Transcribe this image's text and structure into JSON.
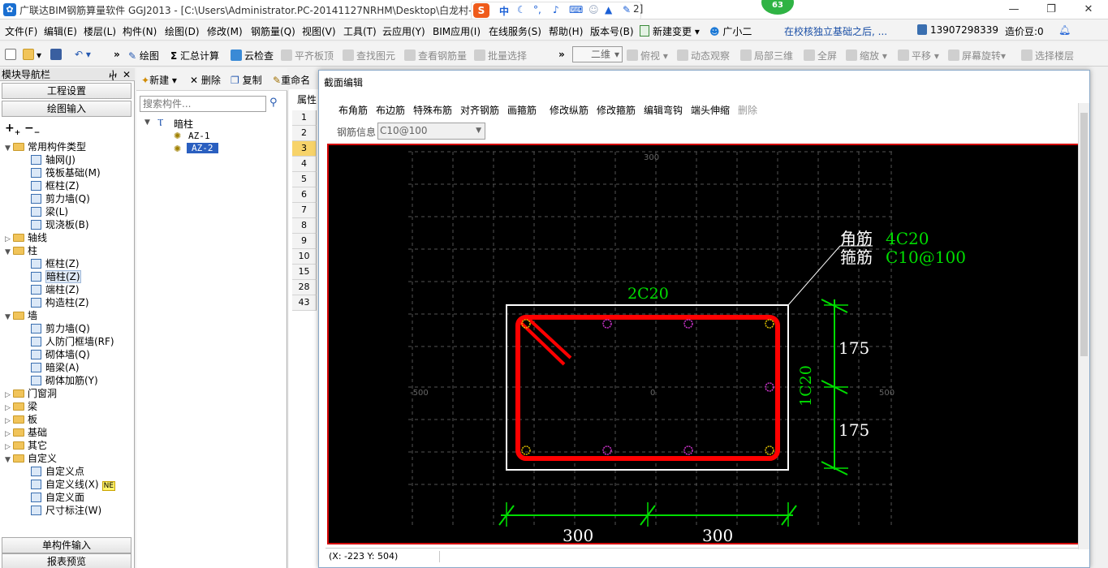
{
  "title": {
    "text": "广联达BIM钢筋算量软件 GGJ2013 - [C:\\Users\\Administrator.PC-20141127NRHM\\Desktop\\白龙村-",
    "right_fragment": "2]",
    "badge": "63"
  },
  "menu": {
    "items": [
      "文件(F)",
      "编辑(E)",
      "楼层(L)",
      "构件(N)",
      "绘图(D)",
      "修改(M)",
      "钢筋量(Q)",
      "视图(V)",
      "工具(T)",
      "云应用(Y)",
      "BIM应用(I)",
      "在线服务(S)",
      "帮助(H)",
      "版本号(B)",
      "新建变更",
      "广小二"
    ],
    "marquee": "在校核独立基础之后, ...",
    "phone": "13907298339",
    "beans": "造价豆:0"
  },
  "toolbar": {
    "draw": "绘图",
    "sum": "汇总计算",
    "cloud": "云检查",
    "align_top": "平齐板顶",
    "find": "查找图元",
    "view_rebar": "查看钢筋量",
    "batch": "批量选择",
    "view_mode": "二维",
    "top_view": "俯视",
    "dynamic": "动态观察",
    "local3d": "局部三维",
    "fullscreen": "全屏",
    "zoom": "缩放",
    "pan": "平移",
    "rotate": "屏幕旋转",
    "select_floor": "选择楼层"
  },
  "nav": {
    "title": "模块导航栏",
    "project": "工程设置",
    "drawing": "绘图输入",
    "single": "单构件输入",
    "report": "报表预览",
    "tree": [
      {
        "label": "常用构件类型",
        "level": 0,
        "folder": true,
        "open": true
      },
      {
        "label": "轴网(J)",
        "level": 1
      },
      {
        "label": "筏板基础(M)",
        "level": 1
      },
      {
        "label": "框柱(Z)",
        "level": 1
      },
      {
        "label": "剪力墙(Q)",
        "level": 1
      },
      {
        "label": "梁(L)",
        "level": 1
      },
      {
        "label": "现浇板(B)",
        "level": 1
      },
      {
        "label": "轴线",
        "level": 0,
        "folder": true,
        "open": false
      },
      {
        "label": "柱",
        "level": 0,
        "folder": true,
        "open": true
      },
      {
        "label": "框柱(Z)",
        "level": 1
      },
      {
        "label": "暗柱(Z)",
        "level": 1,
        "selected": true
      },
      {
        "label": "端柱(Z)",
        "level": 1
      },
      {
        "label": "构造柱(Z)",
        "level": 1
      },
      {
        "label": "墙",
        "level": 0,
        "folder": true,
        "open": true
      },
      {
        "label": "剪力墙(Q)",
        "level": 1
      },
      {
        "label": "人防门框墙(RF)",
        "level": 1
      },
      {
        "label": "砌体墙(Q)",
        "level": 1
      },
      {
        "label": "暗梁(A)",
        "level": 1
      },
      {
        "label": "砌体加筋(Y)",
        "level": 1
      },
      {
        "label": "门窗洞",
        "level": 0,
        "folder": true,
        "open": false
      },
      {
        "label": "梁",
        "level": 0,
        "folder": true,
        "open": false
      },
      {
        "label": "板",
        "level": 0,
        "folder": true,
        "open": false
      },
      {
        "label": "基础",
        "level": 0,
        "folder": true,
        "open": false
      },
      {
        "label": "其它",
        "level": 0,
        "folder": true,
        "open": false
      },
      {
        "label": "自定义",
        "level": 0,
        "folder": true,
        "open": true
      },
      {
        "label": "自定义点",
        "level": 1
      },
      {
        "label": "自定义线(X)",
        "level": 1,
        "badge": "NE"
      },
      {
        "label": "自定义面",
        "level": 1
      },
      {
        "label": "尺寸标注(W)",
        "level": 1
      }
    ]
  },
  "components": {
    "new": "新建",
    "delete": "删除",
    "copy": "复制",
    "rename": "重命名",
    "search_placeholder": "搜索构件...",
    "root": "暗柱",
    "items": [
      "AZ-1",
      "AZ-2"
    ]
  },
  "grid": {
    "header": "属性",
    "rows": [
      "1",
      "2",
      "3",
      "4",
      "5",
      "6",
      "7",
      "8",
      "9",
      "10",
      "15",
      "28",
      "43"
    ]
  },
  "dialog": {
    "title": "截面编辑",
    "tools": [
      "布角筋",
      "布边筋",
      "特殊布筋",
      "对齐钢筋",
      "画箍筋",
      "修改纵筋",
      "修改箍筋",
      "编辑弯钩",
      "端头伸缩",
      "删除"
    ],
    "rebar_info_label": "钢筋信息",
    "rebar_info_value": "C10@100",
    "status": "(X: -223 Y: 504)"
  },
  "canvas": {
    "corner_label": "角筋",
    "corner_value": "4C20",
    "stirrup_label": "箍筋",
    "stirrup_value": "C10@100",
    "top_bars": "2C20",
    "side_bars": "1C20",
    "dim_h1": "300",
    "dim_h2": "300",
    "dim_v1": "175",
    "dim_v2": "175",
    "axis_left": "-500",
    "axis_center": "0",
    "axis_right": "500",
    "axis_top": "300",
    "colors": {
      "rebar": "#ff0000",
      "dim": "#00dd00",
      "white": "#ffffff",
      "grid": "#555555",
      "node": "#cc33cc"
    }
  }
}
